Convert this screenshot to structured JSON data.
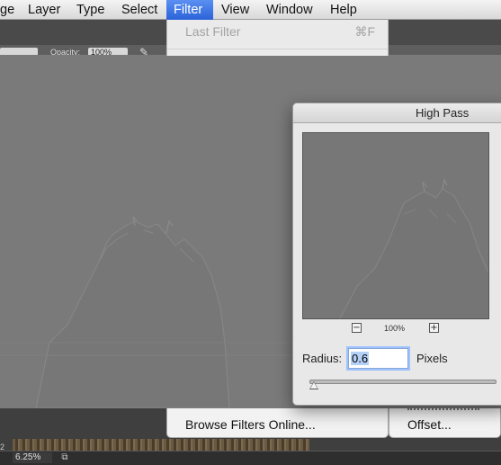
{
  "menubar": {
    "items": [
      {
        "label": "ge",
        "active": false
      },
      {
        "label": "Layer",
        "active": false
      },
      {
        "label": "Type",
        "active": false
      },
      {
        "label": "Select",
        "active": false
      },
      {
        "label": "Filter",
        "active": true
      },
      {
        "label": "View",
        "active": false
      },
      {
        "label": "Window",
        "active": false
      },
      {
        "label": "Help",
        "active": false
      }
    ]
  },
  "optionsbar": {
    "opacity_label": "Opacity:",
    "opacity_value": "100%"
  },
  "filter_menu": {
    "last_filter_label": "Last Filter",
    "last_filter_shortcut": "⌘F",
    "browse_online_label": "Browse Filters Online..."
  },
  "submenu": {
    "offset_label": "Offset..."
  },
  "dialog": {
    "title": "High Pass",
    "zoom_percent": "100%",
    "zoom_out_icon": "−",
    "zoom_in_icon": "+",
    "radius_label": "Radius:",
    "radius_value": "0.6",
    "units_label": "Pixels"
  },
  "status": {
    "zoom": "6.25%",
    "page_num": "2"
  },
  "colors": {
    "menu_highlight": "#3a72e3",
    "canvas_gray": "#7a7a7a"
  }
}
